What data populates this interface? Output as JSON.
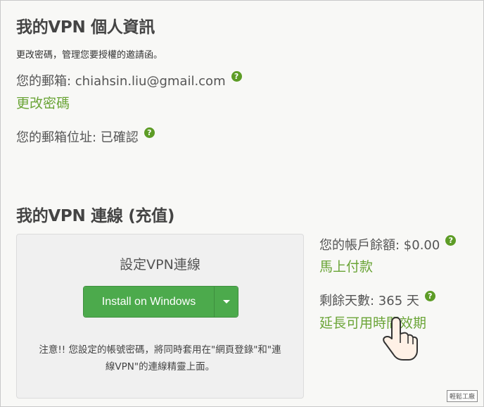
{
  "account_section": {
    "title": "我的VPN 個人資訊",
    "subtitle": "更改密碼，管理您要授權的邀請函。",
    "email_line": "您的郵箱: chiahsin.liu@gmail.com",
    "change_password_link": "更改密碼",
    "email_status_line": "您的郵箱位址: 已確認",
    "help_icon_label": "?"
  },
  "connection_section": {
    "title": "我的VPN 連線 (充值)",
    "setup_panel": {
      "title": "設定VPN連線",
      "install_button": "Install on Windows",
      "note": "注意!! 您設定的帳號密碼，將同時套用在\"網頁登錄\"和\"連線VPN\"的連線精靈上面。"
    },
    "balance_line": "您的帳戶餘額: $0.00",
    "pay_link": "馬上付款",
    "days_line": "剩餘天數: 365 天",
    "extend_link": "延長可用時間效期"
  },
  "watermark": "輕鬆工廠"
}
